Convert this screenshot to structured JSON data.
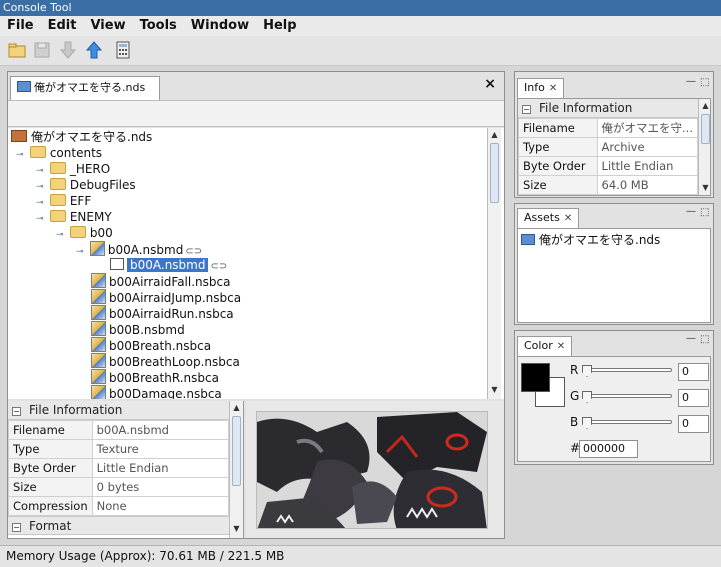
{
  "app": {
    "title": "Console Tool"
  },
  "menu": [
    "File",
    "Edit",
    "View",
    "Tools",
    "Window",
    "Help"
  ],
  "toolbar": {
    "icons": [
      "open-folder-icon",
      "save-icon",
      "download-icon",
      "upload-icon",
      "calculator-icon"
    ]
  },
  "doc_tab": {
    "label": "俺がオマエを守る.nds",
    "close": "×"
  },
  "tree": {
    "root": "俺がオマエを守る.nds",
    "contents": "contents",
    "hero": "_HERO",
    "debug": "DebugFiles",
    "eff": "EFF",
    "enemy": "ENEMY",
    "b00": "b00",
    "b00a": "b00A.nsbmd",
    "b00a_child": "b00A.nsbmd",
    "files": [
      "b00AirraidFall.nsbca",
      "b00AirraidJump.nsbca",
      "b00AirraidRun.nsbca",
      "b00B.nsbmd",
      "b00Breath.nsbca",
      "b00BreathLoop.nsbca",
      "b00BreathR.nsbca",
      "b00Damage.nsbca"
    ]
  },
  "file_info": {
    "header": "File Information",
    "rows": [
      {
        "k": "Filename",
        "v": "b00A.nsbmd"
      },
      {
        "k": "Type",
        "v": "Texture"
      },
      {
        "k": "Byte Order",
        "v": "Little Endian"
      },
      {
        "k": "Size",
        "v": "0 bytes"
      },
      {
        "k": "Compression",
        "v": "None"
      }
    ],
    "next_section": "Format"
  },
  "info_panel": {
    "tab": "Info",
    "header": "File Information",
    "rows": [
      {
        "k": "Filename",
        "v": "俺がオマエを守..."
      },
      {
        "k": "Type",
        "v": "Archive"
      },
      {
        "k": "Byte Order",
        "v": "Little Endian"
      },
      {
        "k": "Size",
        "v": "64.0 MB"
      }
    ]
  },
  "assets_panel": {
    "tab": "Assets",
    "item": "俺がオマエを守る.nds"
  },
  "color_panel": {
    "tab": "Color",
    "r_label": "R",
    "g_label": "G",
    "b_label": "B",
    "r": "0",
    "g": "0",
    "b": "0",
    "hash": "#",
    "hex": "000000",
    "foreground": "#000000",
    "background": "#ffffff"
  },
  "status": {
    "text": "Memory Usage (Approx): 70.61 MB / 221.5 MB"
  }
}
